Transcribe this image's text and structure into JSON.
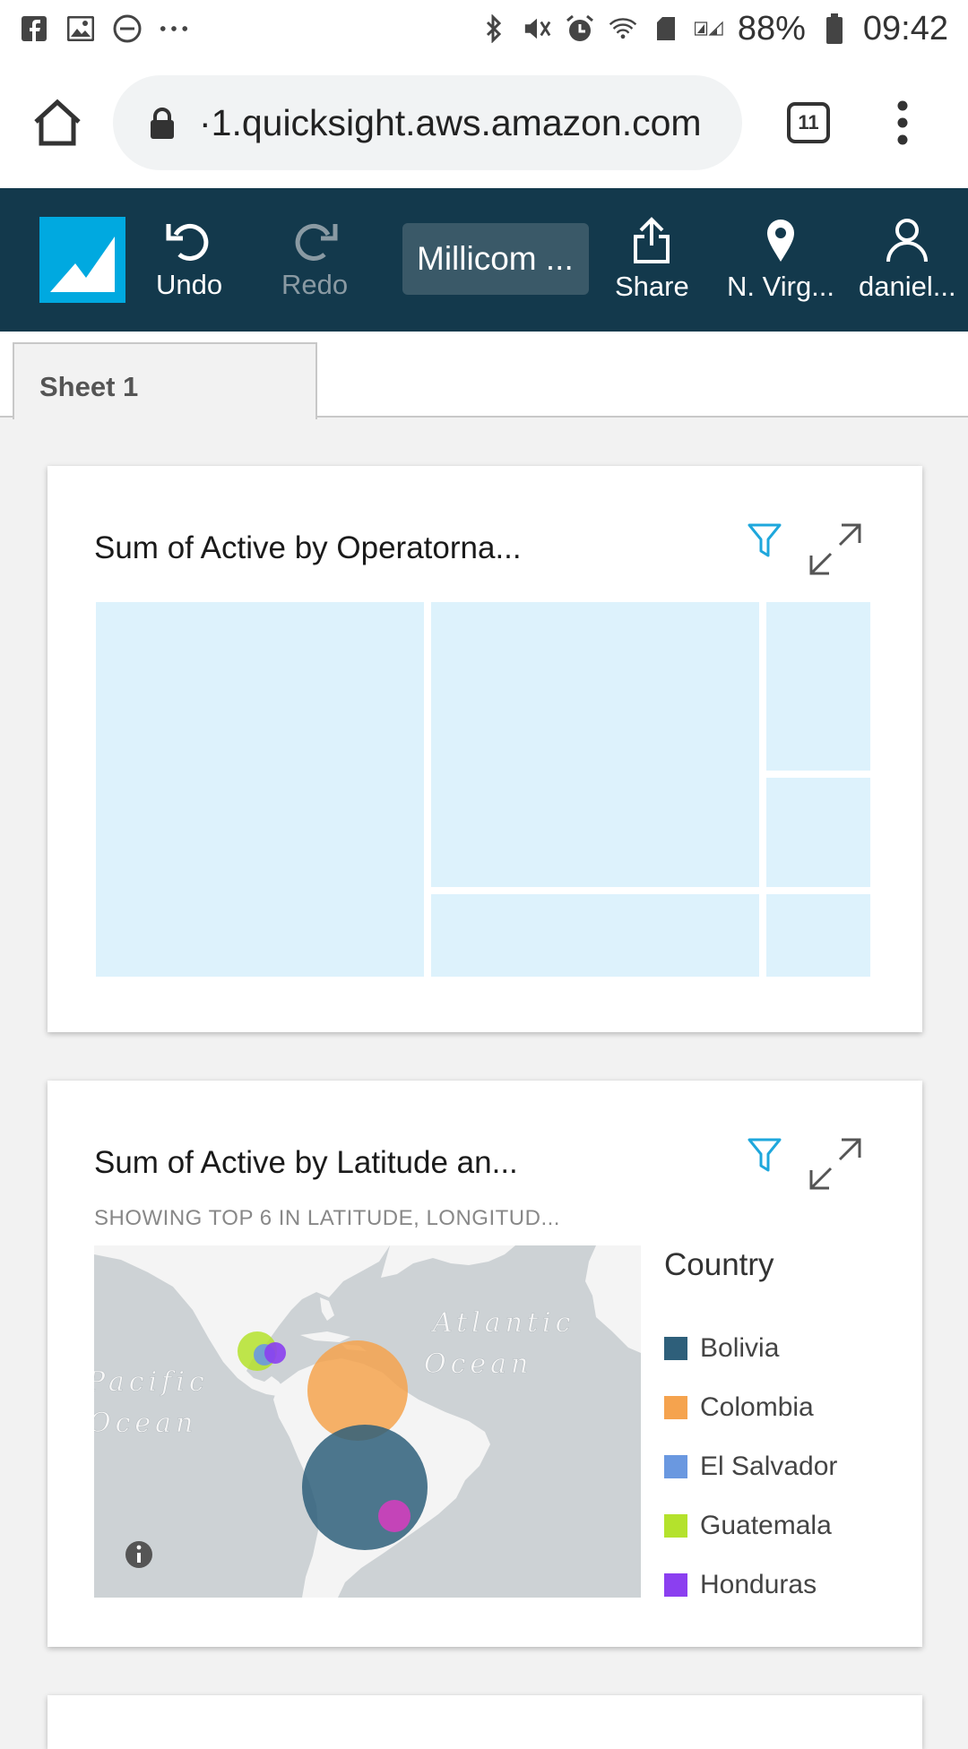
{
  "status_bar": {
    "battery": "88%",
    "time": "09:42",
    "icons": [
      "facebook-icon",
      "gallery-icon",
      "do-not-disturb-icon",
      "more-dots-icon",
      "bluetooth-icon",
      "mute-icon",
      "alarm-icon",
      "wifi-icon",
      "signal-icon",
      "battery-icon"
    ]
  },
  "browser": {
    "url": "·1.quicksight.aws.amazon.com",
    "tab_count": "11"
  },
  "toolbar": {
    "undo_label": "Undo",
    "redo_label": "Redo",
    "analysis_name": "Millicom ...",
    "share_label": "Share",
    "region_label": "N. Virg...",
    "user_label": "daniel..."
  },
  "sheet_tab": "Sheet 1",
  "visual1": {
    "title": "Sum of Active by Operatorna..."
  },
  "visual2": {
    "title": "Sum of Active by Latitude an...",
    "subtitle": "SHOWING TOP 6 IN LATITUDE, LONGITUD...",
    "map_labels": {
      "atlantic_1": "Atlantic",
      "atlantic_2": "Ocean",
      "pacific_1": "Pacific",
      "pacific_2": "Ocean"
    },
    "legend_title": "Country",
    "legend": [
      {
        "label": "Bolivia",
        "color": "#2e5f7a"
      },
      {
        "label": "Colombia",
        "color": "#f5a34e"
      },
      {
        "label": "El Salvador",
        "color": "#6a98e0"
      },
      {
        "label": "Guatemala",
        "color": "#b4e22c"
      },
      {
        "label": "Honduras",
        "color": "#8b3ff0"
      }
    ]
  },
  "colors": {
    "toolbar_bg": "#13394c",
    "accent": "#00a9e0",
    "treemap_fill": "#ddf2fc"
  }
}
